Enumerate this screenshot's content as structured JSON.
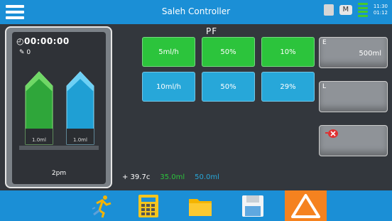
{
  "header": {
    "title": "Saleh Controller",
    "chat_label": "M",
    "clock_line1": "11:30",
    "clock_line2": "01:12"
  },
  "left_panel": {
    "timer": "00:00:00",
    "count": "0",
    "bottles": [
      {
        "name": "green",
        "volume": "1.0ml",
        "fill_level": 0.85
      },
      {
        "name": "blue",
        "volume": "1.0ml",
        "fill_level": 0.85
      }
    ],
    "bottom_label": "2pm"
  },
  "center": {
    "label": "PF",
    "rows": [
      {
        "cells": [
          "5ml/h",
          "50%",
          "10%"
        ],
        "color": "green"
      },
      {
        "cells": [
          "10ml/h",
          "50%",
          "29%"
        ],
        "color": "blue"
      }
    ]
  },
  "right_buttons": [
    {
      "label": "E",
      "value": "500ml"
    },
    {
      "label": "L",
      "value": ""
    },
    {
      "label": "",
      "value": ""
    }
  ],
  "footer": {
    "temp": "+ 39.7c",
    "green_val": "35.0ml",
    "blue_val": "50.0ml"
  },
  "colors": {
    "accent": "#1b8fd6",
    "green": "#2cc43c",
    "blue": "#27a7d9",
    "warning": "#f5821f"
  },
  "icons": {
    "menu": "hamburger-menu-icon",
    "run": "running-person-icon",
    "calc": "calculator-icon",
    "folder": "folder-icon",
    "save": "save-icon",
    "warning": "warning-triangle-icon"
  }
}
